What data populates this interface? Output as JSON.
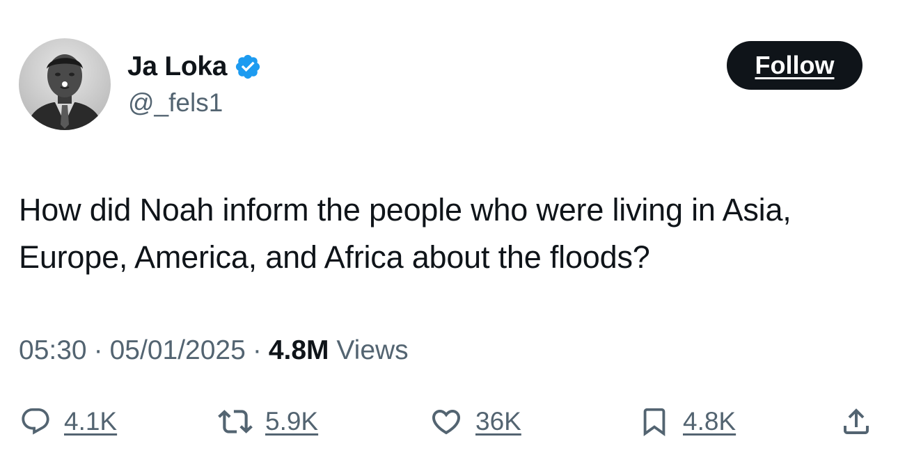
{
  "author": {
    "display_name": "Ja Loka",
    "handle": "@_fels1",
    "verified": true
  },
  "follow_button": {
    "label": "Follow"
  },
  "tweet": {
    "text": "How did Noah inform the people who were living in Asia, Europe, America, and Africa about the floods?",
    "time": "05:30",
    "date": "05/01/2025",
    "views_count": "4.8M",
    "views_label": "Views"
  },
  "actions": {
    "reply": {
      "icon": "reply-icon",
      "count": "4.1K"
    },
    "retweet": {
      "icon": "retweet-icon",
      "count": "5.9K"
    },
    "like": {
      "icon": "heart-icon",
      "count": "36K"
    },
    "bookmark": {
      "icon": "bookmark-icon",
      "count": "4.8K"
    },
    "share": {
      "icon": "share-icon"
    }
  },
  "colors": {
    "text_primary": "#0f1419",
    "text_secondary": "#536471",
    "verified_blue": "#1d9bf0",
    "follow_bg": "#0f1419"
  }
}
